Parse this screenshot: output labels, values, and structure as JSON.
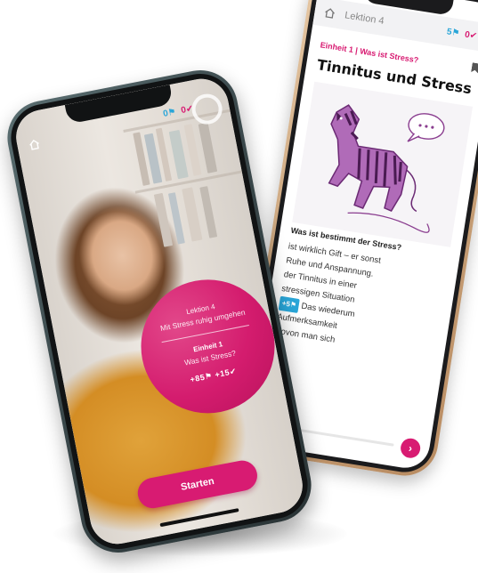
{
  "back_phone": {
    "lesson_label": "Lektion 4",
    "stats": {
      "blue": "5⚑",
      "pink": "0✔",
      "green": "•"
    },
    "unit_heading": "Einheit 1 | Was ist Stress?",
    "title": "Tinnitus und Stress",
    "caption": "Was ist bestimmt der Stress?",
    "body_lines": [
      "ist wirklich Gift – er sonst",
      "Ruhe und Anspannung.",
      "der Tinnitus in einer",
      "stressigen Situation",
      "Das wiederum",
      "Aufmerksamkeit",
      "wovon man sich"
    ],
    "inline_tag": "+5⚑",
    "next_label": "›"
  },
  "front_phone": {
    "stats": {
      "blue": "0⚑",
      "pink": "0✔"
    },
    "card": {
      "lesson_line": "Lektion 4",
      "lesson_subtitle": "Mit Stress ruhig umgehen",
      "unit_line": "Einheit 1",
      "unit_subtitle": "Was ist Stress?",
      "rewards": "+85⚑ +15✔"
    },
    "start_button_label": "Starten"
  },
  "colors": {
    "brand_pink": "#d81b72",
    "accent_blue": "#2aa6d8",
    "accent_green": "#3bb38b"
  }
}
